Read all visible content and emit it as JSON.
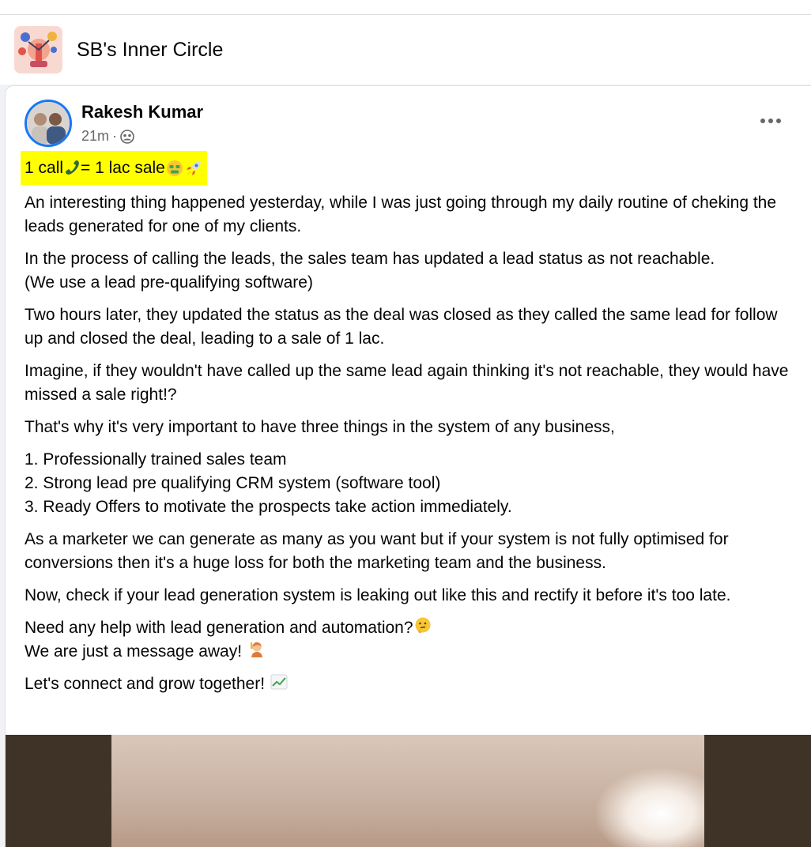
{
  "group": {
    "name": "SB's Inner Circle",
    "avatar_icon": "group-illustration-icon"
  },
  "post": {
    "author": "Rakesh Kumar",
    "time": "21m",
    "separator": "·",
    "audience_icon": "group-audience-icon",
    "headline": {
      "part1": "1 call",
      "part2": " = 1 lac sale ",
      "highlight_color": "#ffff00"
    },
    "paragraphs": [
      [
        "An interesting thing happened yesterday, while I was just going through my daily routine of cheking the leads generated for one of my clients."
      ],
      [
        "In the process of calling the leads, the sales team has updated a lead status as not reachable.",
        "(We use a lead pre-qualifying software)"
      ],
      [
        "Two hours later, they updated the status as the deal was closed as they called the same lead for follow up and closed the deal, leading to a sale of 1 lac."
      ],
      [
        "Imagine, if they wouldn't have called up the same lead again thinking it's not reachable, they would have missed a sale right!?"
      ],
      [
        "That's why it's very important to have three things in the system of any business,"
      ],
      [
        "1. Professionally trained sales team",
        "2. Strong lead pre qualifying CRM system (software tool)",
        "3. Ready Offers to motivate the prospects take action immediately."
      ],
      [
        "As a marketer we can generate as many as you want but if your system is not fully optimised for conversions then it's a huge loss for both the marketing team and the business."
      ],
      [
        "Now, check if your lead generation system is leaking out like this and rectify it before it's too late."
      ]
    ],
    "cta": {
      "line1": "Need any help with lead generation and automation?",
      "line2": "We are just a message away! ",
      "closing": "Let's connect and grow together! "
    },
    "icons": {
      "phone": "telephone-receiver-icon",
      "money_face": "money-mouth-face-icon",
      "rocket": "rocket-icon",
      "thinking": "thinking-face-icon",
      "raising_hand": "person-raising-hand-icon",
      "chart": "chart-increasing-icon",
      "more": "more-options-icon"
    }
  }
}
